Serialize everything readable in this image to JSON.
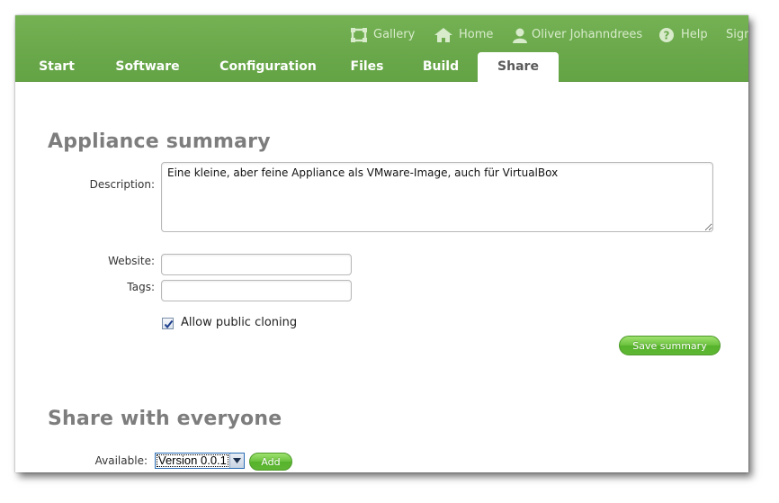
{
  "nav": {
    "utility": [
      {
        "label": "Gallery",
        "icon": "gallery-icon"
      },
      {
        "label": "Home",
        "icon": "home-icon"
      },
      {
        "label": "Oliver Johanndrees",
        "icon": "user-icon"
      },
      {
        "label": "Help",
        "icon": "help-icon"
      },
      {
        "label": "Sign",
        "icon": ""
      }
    ],
    "tabs": [
      "Start",
      "Software",
      "Configuration",
      "Files",
      "Build",
      "Share"
    ],
    "active_tab": "Share"
  },
  "summary": {
    "title": "Appliance summary",
    "description_label": "Description:",
    "description_value": "Eine kleine, aber feine Appliance als VMware-Image, auch für VirtualBox",
    "website_label": "Website:",
    "website_value": "",
    "tags_label": "Tags:",
    "tags_value": "",
    "allow_cloning_label": "Allow public cloning",
    "allow_cloning_checked": true,
    "save_label": "Save summary"
  },
  "share": {
    "title": "Share with everyone",
    "available_label": "Available:",
    "version_selected": "Version 0.0.1",
    "add_label": "Add"
  },
  "colors": {
    "header_green": "#6aa84b",
    "button_green": "#5fb733",
    "heading_gray": "#7d7d7d"
  }
}
